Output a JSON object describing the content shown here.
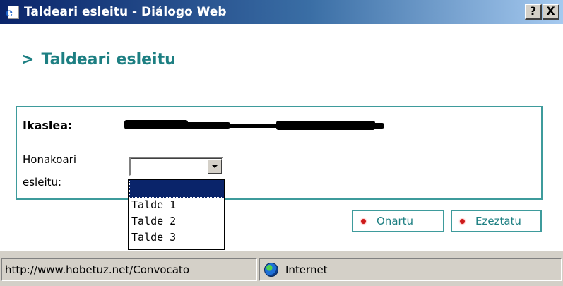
{
  "window": {
    "title": "Taldeari esleitu - Diálogo Web",
    "help_label": "?",
    "close_label": "X"
  },
  "page": {
    "heading_arrow": ">",
    "heading": "Taldeari esleitu"
  },
  "form": {
    "student_label": "Ikaslea:",
    "assign_label_line1": "Honakoari",
    "assign_label_line2": "esleitu:",
    "select": {
      "selected_value": "",
      "options": [
        "",
        "Talde 1",
        "Talde 2",
        "Talde 3"
      ]
    }
  },
  "buttons": {
    "ok_label": "Onartu",
    "cancel_label": "Ezeztatu"
  },
  "statusbar": {
    "url": "http://www.hobetuz.net/Convocato",
    "zone": "Internet"
  },
  "colors": {
    "accent": "#1d7f82",
    "border": "#3e9b9c",
    "titlebar": "#0a246a",
    "bullet": "#cc1a1a"
  },
  "icons": {
    "window": "internet-explorer-icon",
    "zone": "globe-icon",
    "dropdown": "chevron-down-icon"
  }
}
